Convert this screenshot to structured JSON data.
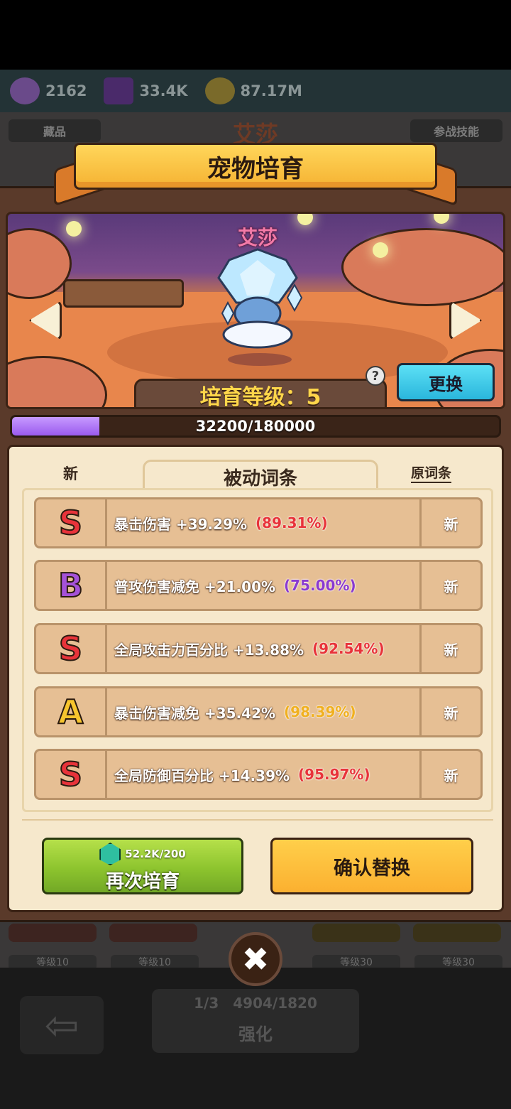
{
  "hud": {
    "items": [
      {
        "value": "2162",
        "icon": "gold-pot-icon"
      },
      {
        "value": "33.4K",
        "icon": "purple-cube-icon"
      },
      {
        "value": "87.17M",
        "icon": "coin-icon"
      }
    ]
  },
  "background": {
    "pet_name": "艾莎",
    "tab_collection": "藏品",
    "tab_battle_skills": "参战技能",
    "level_badges": [
      "等级10",
      "等级10",
      "等级30",
      "等级30"
    ],
    "enhance_counts": [
      "1/3",
      "4904/1820"
    ],
    "enhance_label": "强化"
  },
  "dialog": {
    "title": "宠物培育",
    "pet_name": "艾莎",
    "level_label": "培育等级：5",
    "help": "?",
    "swap_label": "更换",
    "progress": {
      "current": 32200,
      "max": 180000,
      "text": "32200/180000",
      "fraction": 0.179
    },
    "tabs": {
      "left": "新",
      "active": "被动词条",
      "right": "原词条"
    },
    "attributes": [
      {
        "grade": "S",
        "grade_color": "#e8333a",
        "text": "暴击伤害 +39.29%",
        "percent": "(89.31%)",
        "percent_color": "#e8333a",
        "new": "新"
      },
      {
        "grade": "B",
        "grade_color": "#a552d8",
        "text": "普攻伤害减免 +21.00%",
        "percent": "(75.00%)",
        "percent_color": "#8a3ad0",
        "new": "新"
      },
      {
        "grade": "S",
        "grade_color": "#e8333a",
        "text": "全局攻击力百分比 +13.88%",
        "percent": "(92.54%)",
        "percent_color": "#e8333a",
        "new": "新"
      },
      {
        "grade": "A",
        "grade_color": "#f7c52e",
        "text": "暴击伤害减免 +35.42%",
        "percent": "(98.39%)",
        "percent_color": "#f0b020",
        "new": "新"
      },
      {
        "grade": "S",
        "grade_color": "#e8333a",
        "text": "全局防御百分比 +14.39%",
        "percent": "(95.97%)",
        "percent_color": "#e8333a",
        "new": "新"
      }
    ],
    "reroll": {
      "cost": "52.2K/200",
      "label": "再次培育",
      "icon": "gem-icon"
    },
    "confirm_label": "确认替换",
    "close_icon": "close-icon"
  }
}
